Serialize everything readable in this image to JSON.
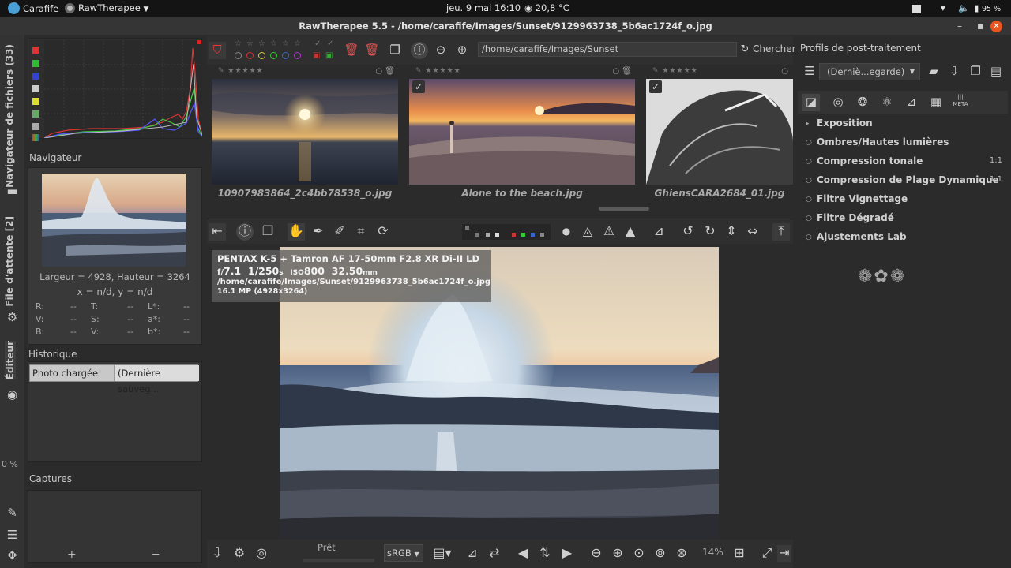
{
  "desktop": {
    "app_label": "Carafife",
    "window_menu": "RawTherapee",
    "clock": "jeu. 9 mai  16:10",
    "weather": "20,8 °C",
    "battery": "95 %"
  },
  "window": {
    "title": "RawTherapee 5.5 - /home/carafife/Images/Sunset/9129963738_5b6ac1724f_o.jpg"
  },
  "vertical_tabs": {
    "file_browser": "Navigateur de fichiers (33)",
    "queue": "File d'attente [2]",
    "editor": "Éditeur",
    "percent": "0 %"
  },
  "navigator": {
    "title": "Navigateur",
    "dimensions": "Largeur = 4928, Hauteur = 3264",
    "coords": "x = n/d, y = n/d",
    "rows": [
      [
        {
          "k": "R:",
          "v": "--"
        },
        {
          "k": "T:",
          "v": "--"
        },
        {
          "k": "L*:",
          "v": "--"
        }
      ],
      [
        {
          "k": "V:",
          "v": "--"
        },
        {
          "k": "S:",
          "v": "--"
        },
        {
          "k": "a*:",
          "v": "--"
        }
      ],
      [
        {
          "k": "B:",
          "v": "--"
        },
        {
          "k": "V:",
          "v": "--"
        },
        {
          "k": "b*:",
          "v": "--"
        }
      ]
    ]
  },
  "history": {
    "title": "Historique",
    "col1": "Photo chargée",
    "col2": "(Dernière sauveg..."
  },
  "snapshots": {
    "title": "Captures",
    "add": "+",
    "remove": "−"
  },
  "file_browser": {
    "path": "/home/carafife/Images/Sunset",
    "search_label": "Chercher:",
    "thumbnails": [
      {
        "name": "10907983864_2c4bb78538_o.jpg"
      },
      {
        "name": "Alone to the beach.jpg"
      },
      {
        "name": "GhiensCARA2684_01.jpg"
      }
    ]
  },
  "image_info": {
    "camera": "PENTAX K-5 + Tamron AF 17-50mm F2.8 XR Di-II LD",
    "aperture_prefix": "f/",
    "aperture": "7.1",
    "shutter": "1/250",
    "shutter_unit": "s",
    "iso_prefix": "ISO",
    "iso": "800",
    "focal": "32.50",
    "focal_unit": "mm",
    "file": "/home/carafife/Images/Sunset/9129963738_5b6ac1724f_o.jpg",
    "megapixels": "16.1 MP (4928x3264)"
  },
  "bottom": {
    "status": "Prêt",
    "profile": "sRGB",
    "zoom": "14%"
  },
  "profiles": {
    "title": "Profils de post-traitement",
    "selected": "(Derniè...egarde)"
  },
  "tools": [
    {
      "name": "Exposition",
      "value": "",
      "expanded": true
    },
    {
      "name": "Ombres/Hautes lumières",
      "value": ""
    },
    {
      "name": "Compression tonale",
      "value": "1:1"
    },
    {
      "name": "Compression de Plage Dynamique",
      "value": "1:1"
    },
    {
      "name": "Filtre Vignettage",
      "value": ""
    },
    {
      "name": "Filtre Dégradé",
      "value": ""
    },
    {
      "name": "Ajustements Lab",
      "value": ""
    }
  ],
  "tool_tab_meta": "META"
}
